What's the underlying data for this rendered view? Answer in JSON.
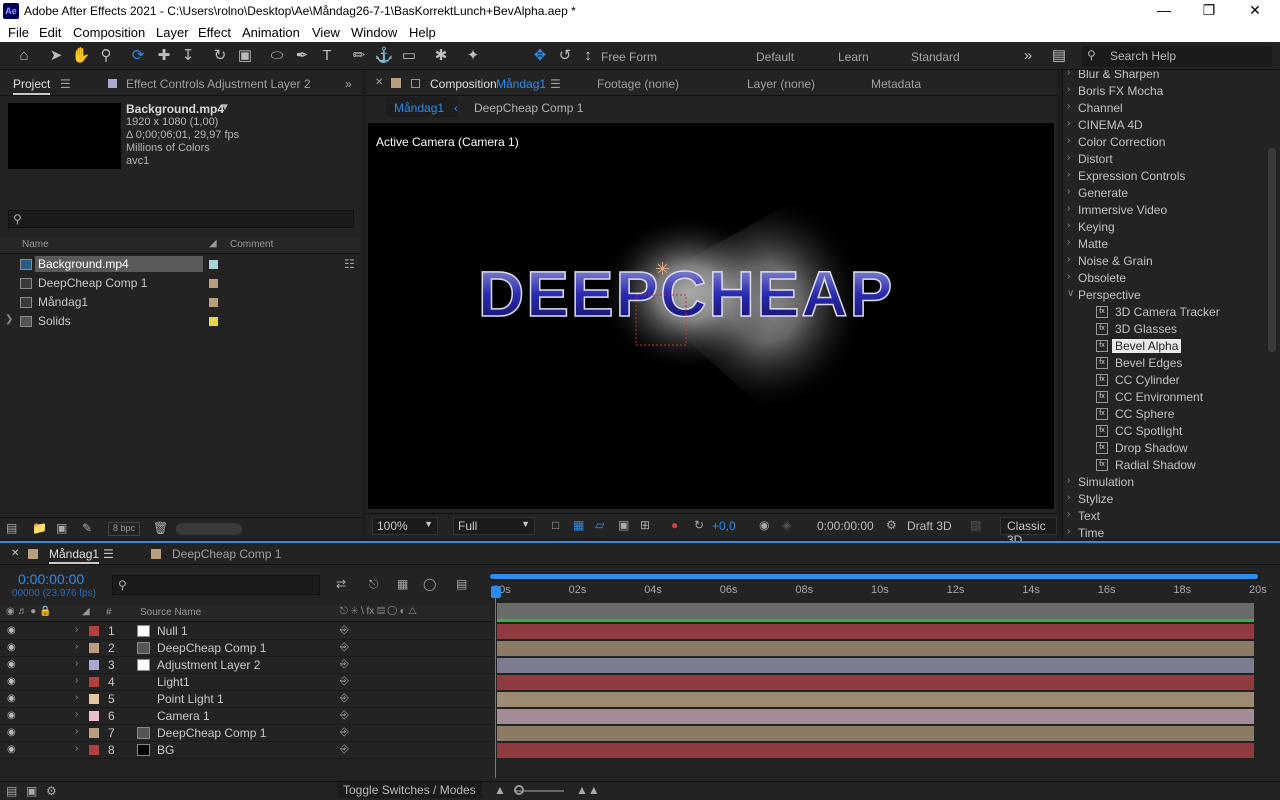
{
  "window": {
    "title": "Adobe After Effects 2021 - C:\\Users\\rolno\\Desktop\\Ae\\Måndag26-7-1\\BasKorrektLunch+BevAlpha.aep *",
    "app_icon": "Ae"
  },
  "menu": [
    "File",
    "Edit",
    "Composition",
    "Layer",
    "Effect",
    "Animation",
    "View",
    "Window",
    "Help"
  ],
  "toolbar": {
    "free_form": "Free Form",
    "workspaces": [
      "Default",
      "Learn",
      "Standard"
    ],
    "search_placeholder": "Search Help"
  },
  "project": {
    "tab": "Project",
    "effect_controls_tab": "Effect Controls Adjustment Layer 2",
    "selected_name": "Background.mp4",
    "info": [
      "1920 x 1080 (1,00)",
      "Δ 0;00;06;01, 29,97 fps",
      "Millions of Colors",
      "avc1"
    ],
    "columns": {
      "name": "Name",
      "comment": "Comment"
    },
    "items": [
      {
        "name": "Background.mp4",
        "color": "#a9d3d0"
      },
      {
        "name": "DeepCheap Comp 1",
        "color": "#b89e7d"
      },
      {
        "name": "Måndag1",
        "color": "#b89e7d"
      },
      {
        "name": "Solids",
        "color": "#e8d64a"
      }
    ],
    "bpc": "8 bpc"
  },
  "composition": {
    "tab_prefix": "Composition",
    "tab_name": "Måndag1",
    "footage": "Footage (none)",
    "layer": "Layer (none)",
    "metadata": "Metadata",
    "breadcrumb": [
      "Måndag1",
      "DeepCheap Comp 1"
    ],
    "camera_label": "Active Camera (Camera 1)",
    "title_text": "DEEPCHEAP",
    "zoom": "100%",
    "resolution": "Full",
    "exposure": "+0,0",
    "timecode": "0:00:00:00",
    "renderer": "Draft 3D",
    "classic": "Classic 3D"
  },
  "effects": {
    "categories_top": [
      {
        "name": "Blur & Sharpen"
      },
      {
        "name": "Boris FX Mocha"
      },
      {
        "name": "Channel"
      },
      {
        "name": "CINEMA 4D"
      },
      {
        "name": "Color Correction"
      },
      {
        "name": "Distort"
      },
      {
        "name": "Expression Controls"
      },
      {
        "name": "Generate"
      },
      {
        "name": "Immersive Video"
      },
      {
        "name": "Keying"
      },
      {
        "name": "Matte"
      },
      {
        "name": "Noise & Grain"
      },
      {
        "name": "Obsolete"
      },
      {
        "name": "Perspective",
        "open": true
      }
    ],
    "perspective_items": [
      "3D Camera Tracker",
      "3D Glasses",
      "Bevel Alpha",
      "Bevel Edges",
      "CC Cylinder",
      "CC Environment",
      "CC Sphere",
      "CC Spotlight",
      "Drop Shadow",
      "Radial Shadow"
    ],
    "selected": "Bevel Alpha",
    "categories_bottom": [
      "Simulation",
      "Stylize",
      "Text",
      "Time"
    ]
  },
  "timeline": {
    "tab": "Måndag1",
    "tab2": "DeepCheap Comp 1",
    "timecode": "0:00:00:00",
    "frame": "00000 (23.976 fps)",
    "source_name_header": "Source Name",
    "ticks": [
      "00s",
      "02s",
      "04s",
      "06s",
      "08s",
      "10s",
      "12s",
      "14s",
      "16s",
      "18s",
      "20s"
    ],
    "layers": [
      {
        "num": "1",
        "name": "Null 1",
        "label": "#b2403f",
        "bar": "#8f3b3f"
      },
      {
        "num": "2",
        "name": "DeepCheap Comp 1",
        "label": "#b89e7d",
        "bar": "#8b7b64"
      },
      {
        "num": "3",
        "name": "Adjustment Layer 2",
        "label": "#a9a9d1",
        "bar": "#7b7b92"
      },
      {
        "num": "4",
        "name": "Light1",
        "label": "#b2403f",
        "bar": "#8f3b3f"
      },
      {
        "num": "5",
        "name": "Point Light 1",
        "label": "#e4c59e",
        "bar": "#9e8b73"
      },
      {
        "num": "6",
        "name": "Camera 1",
        "label": "#e7bfd0",
        "bar": "#a38c96"
      },
      {
        "num": "7",
        "name": "DeepCheap Comp 1",
        "label": "#b89e7d",
        "bar": "#8b7b64"
      },
      {
        "num": "8",
        "name": "BG",
        "label": "#b2403f",
        "bar": "#8f3b3f"
      }
    ],
    "toggle_label": "Toggle Switches / Modes"
  },
  "colors": {
    "accent": "#2d8ceb"
  }
}
